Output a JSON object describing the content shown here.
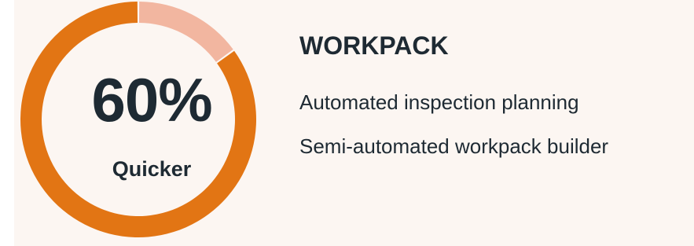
{
  "chart_data": {
    "type": "pie",
    "center_value": "60%",
    "center_label": "Quicker",
    "slices": [
      {
        "value": 85,
        "color": "#e27514"
      },
      {
        "value": 15,
        "color": "#f2b6a0"
      }
    ]
  },
  "panel": {
    "title": "WORKPACK",
    "features": [
      "Automated inspection planning",
      "Semi-automated workpack builder"
    ]
  },
  "colors": {
    "background": "#fcf6f2",
    "text": "#1e2a33",
    "accent": "#e27514",
    "accent_light": "#f2b6a0"
  }
}
